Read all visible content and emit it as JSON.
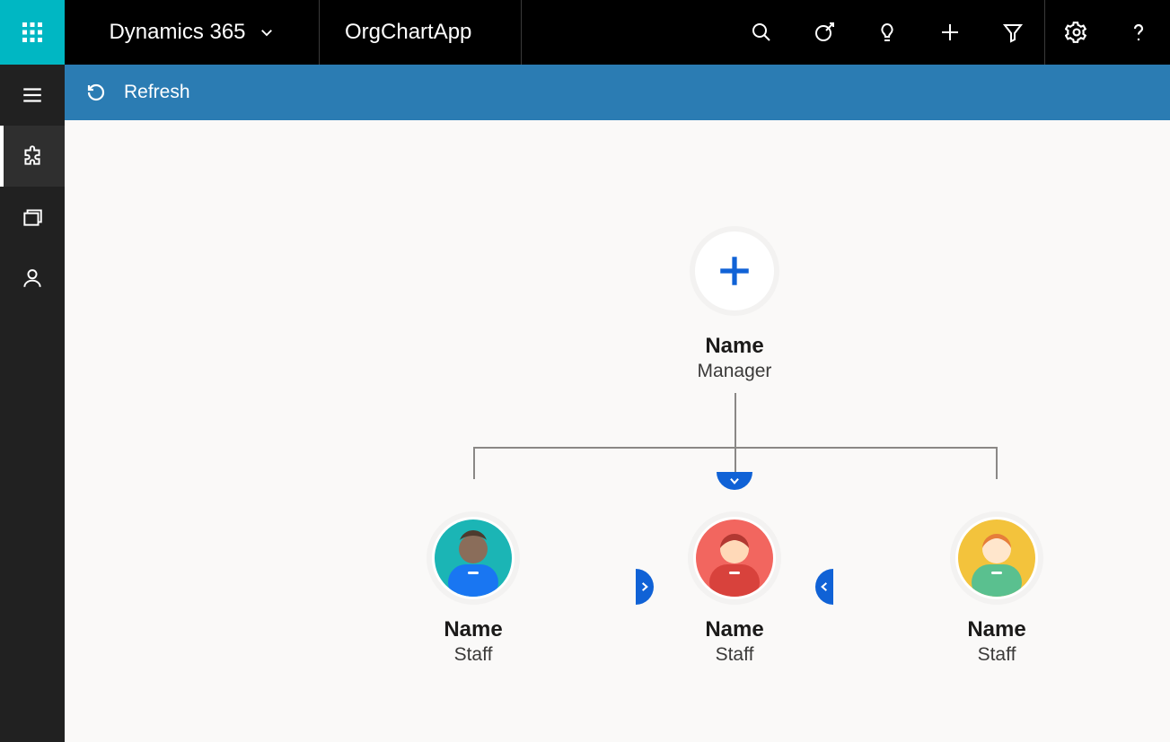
{
  "header": {
    "brand": "Dynamics 365",
    "app_name": "OrgChartApp"
  },
  "commandbar": {
    "refresh_label": "Refresh"
  },
  "orgchart": {
    "root": {
      "name": "Name",
      "role": "Manager"
    },
    "children": [
      {
        "name": "Name",
        "role": "Staff"
      },
      {
        "name": "Name",
        "role": "Staff"
      },
      {
        "name": "Name",
        "role": "Staff"
      }
    ]
  }
}
